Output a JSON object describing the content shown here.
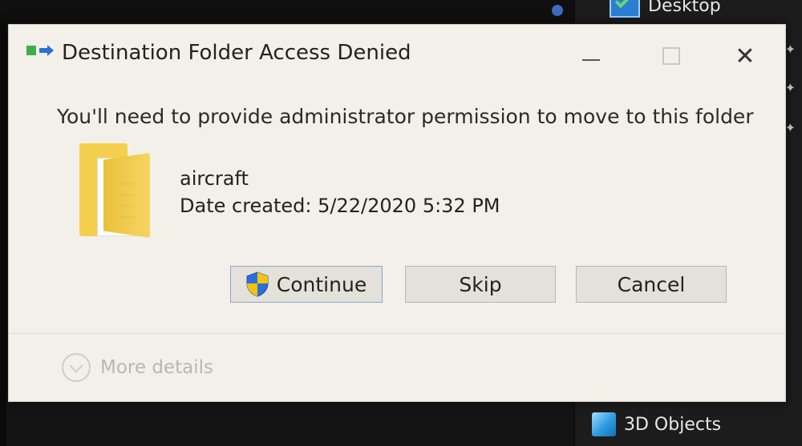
{
  "background": {
    "nav_items": [
      {
        "label": "Desktop",
        "icon": "desktop-icon"
      },
      {
        "label": "3D Objects",
        "icon": "cube-icon"
      }
    ]
  },
  "dialog": {
    "title": "Destination Folder Access Denied",
    "title_icon": "move-folder-icon",
    "message": "You'll need to provide administrator permission to move to this folder",
    "file": {
      "icon": "folder-icon",
      "name": "aircraft",
      "date_created": "Date created: 5/22/2020 5:32 PM"
    },
    "buttons": {
      "continue": "Continue",
      "skip": "Skip",
      "cancel": "Cancel"
    },
    "more_details": "More details",
    "window_controls": [
      "minimize",
      "maximize",
      "close"
    ]
  },
  "colors": {
    "dialog_bg": "#f2f0e9",
    "shield_blue": "#2d6fd6",
    "shield_yellow": "#f5c211",
    "folder_yellow": "#f3cf4d"
  }
}
